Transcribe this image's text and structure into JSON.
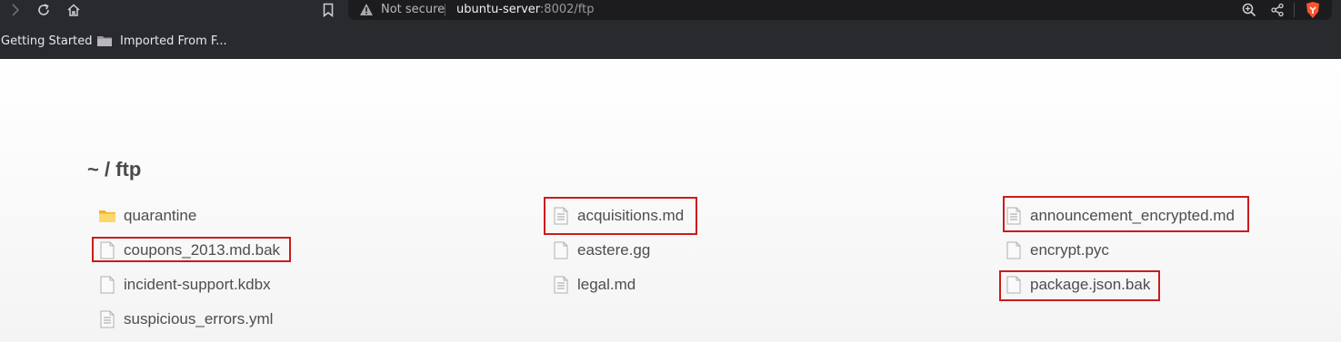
{
  "browser": {
    "address_bar": {
      "security_label": "Not secure",
      "host": "ubuntu-server",
      "path": ":8002/ftp"
    },
    "bookmarks": [
      {
        "label": "Getting Started"
      },
      {
        "label": "Imported From F..."
      }
    ]
  },
  "page": {
    "breadcrumb": "~ / ftp",
    "files": [
      {
        "name": "quarantine",
        "type": "folder",
        "highlighted": false
      },
      {
        "name": "acquisitions.md",
        "type": "text-file",
        "highlighted": true
      },
      {
        "name": "announcement_encrypted.md",
        "type": "text-file",
        "highlighted": true
      },
      {
        "name": "coupons_2013.md.bak",
        "type": "file",
        "highlighted": true
      },
      {
        "name": "eastere.gg",
        "type": "file",
        "highlighted": false
      },
      {
        "name": "encrypt.pyc",
        "type": "file",
        "highlighted": false
      },
      {
        "name": "incident-support.kdbx",
        "type": "file",
        "highlighted": false
      },
      {
        "name": "legal.md",
        "type": "text-file",
        "highlighted": false
      },
      {
        "name": "package.json.bak",
        "type": "file",
        "highlighted": true
      },
      {
        "name": "suspicious_errors.yml",
        "type": "text-file",
        "highlighted": false
      }
    ],
    "highlight_color": "#cc1b1b"
  }
}
